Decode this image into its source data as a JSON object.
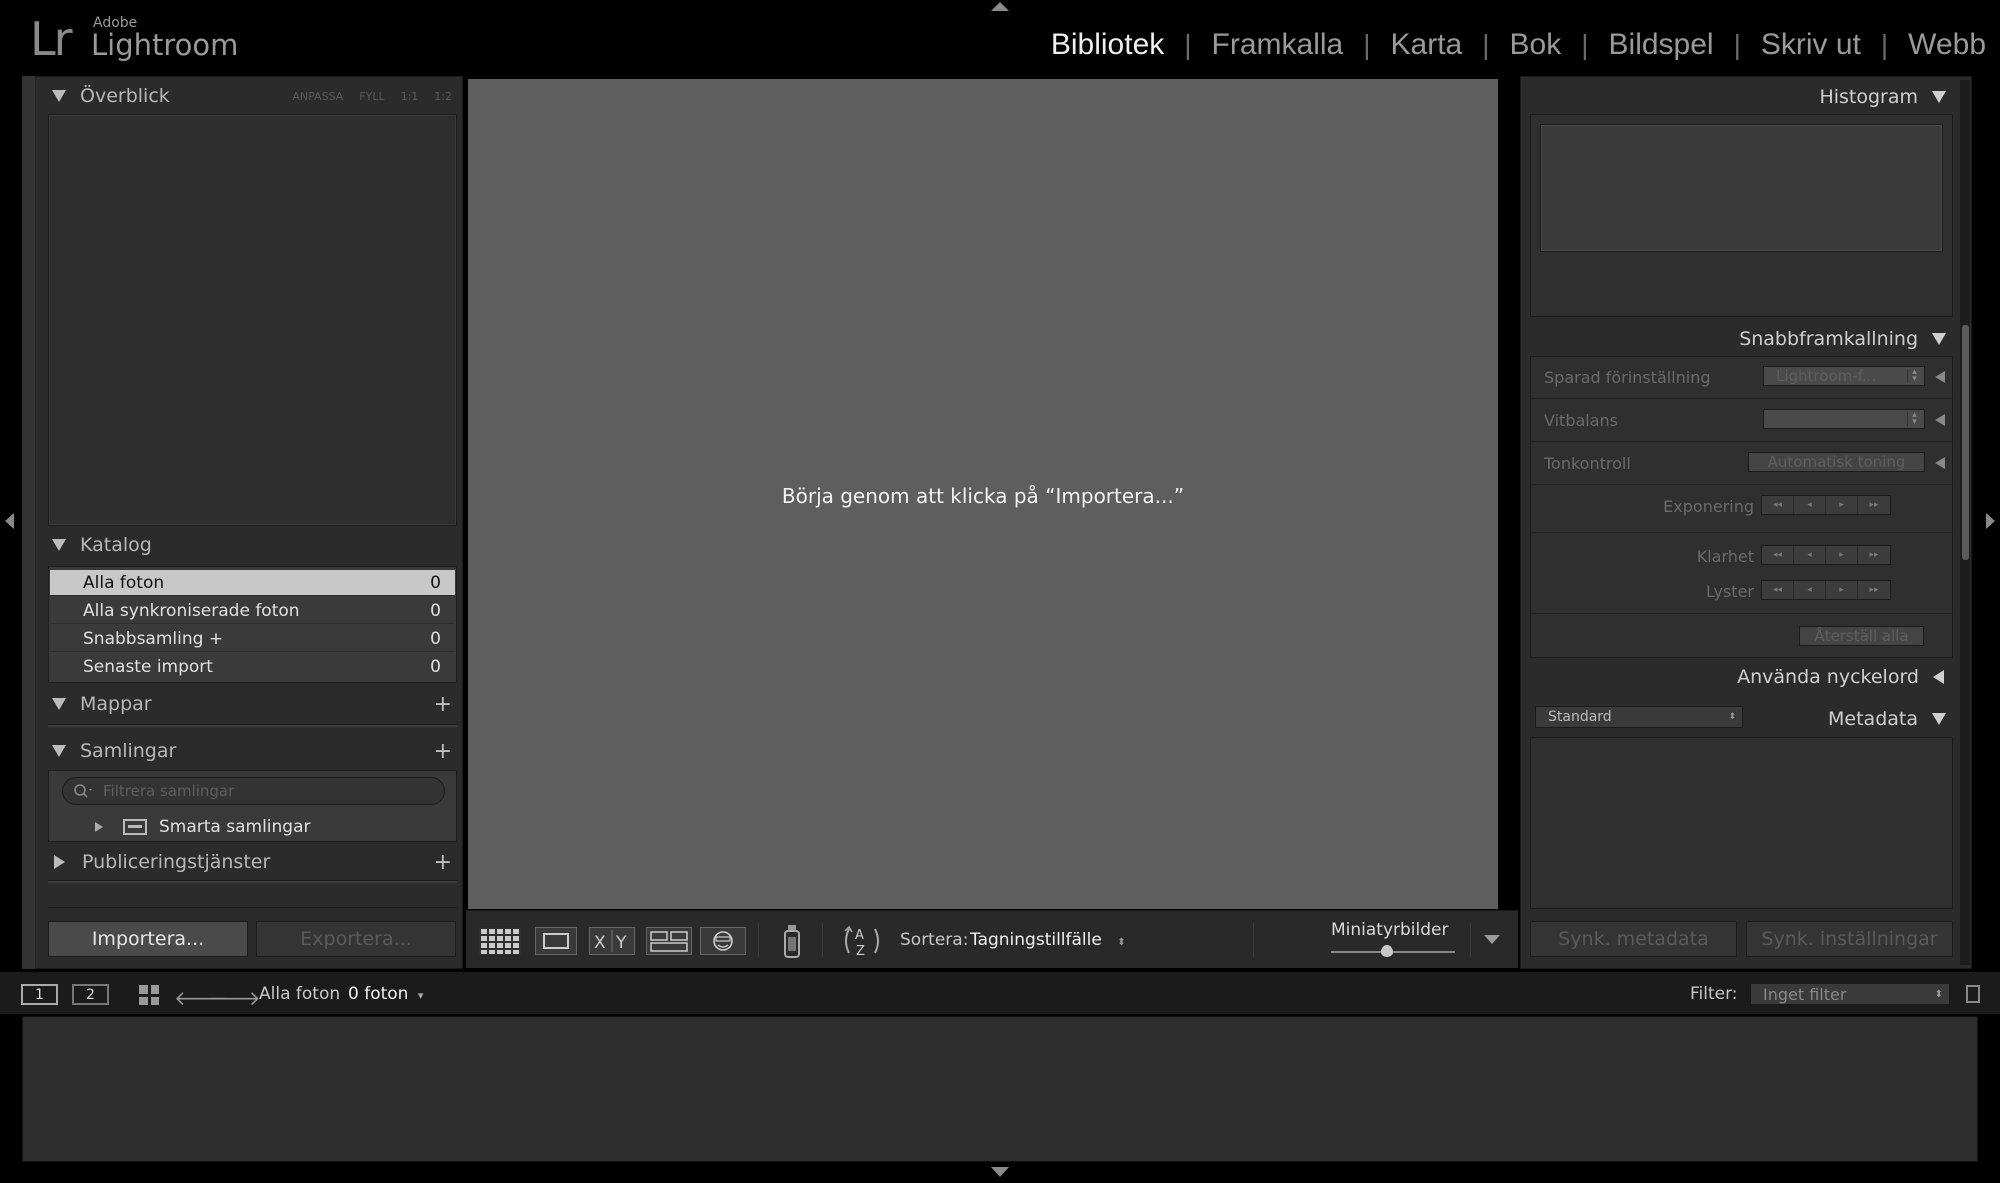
{
  "app": {
    "logo_mark": "Lr",
    "logo_vendor": "Adobe",
    "logo_name": "Lightroom"
  },
  "modules": [
    {
      "label": "Bibliotek",
      "active": true
    },
    {
      "label": "Framkalla",
      "active": false
    },
    {
      "label": "Karta",
      "active": false
    },
    {
      "label": "Bok",
      "active": false
    },
    {
      "label": "Bildspel",
      "active": false
    },
    {
      "label": "Skriv ut",
      "active": false
    },
    {
      "label": "Webb",
      "active": false
    }
  ],
  "left_panel": {
    "navigator": {
      "title": "Överblick",
      "zoom_options": [
        "ANPASSA",
        "FYLL",
        "1:1",
        "1:2"
      ]
    },
    "catalog": {
      "title": "Katalog",
      "items": [
        {
          "label": "Alla foton",
          "count": "0",
          "selected": true
        },
        {
          "label": "Alla synkroniserade foton",
          "count": "0",
          "selected": false
        },
        {
          "label": "Snabbsamling +",
          "count": "0",
          "selected": false
        },
        {
          "label": "Senaste import",
          "count": "0",
          "selected": false
        }
      ]
    },
    "folders": {
      "title": "Mappar",
      "add": "+"
    },
    "collections": {
      "title": "Samlingar",
      "add": "+",
      "filter_placeholder": "Filtrera samlingar",
      "smart_collections": "Smarta samlingar"
    },
    "publish": {
      "title": "Publiceringstjänster",
      "add": "+"
    },
    "import_label": "Importera...",
    "export_label": "Exportera..."
  },
  "center": {
    "message": "Börja genom att klicka på “Importera...”"
  },
  "toolbar": {
    "sort_label": "Sortera:",
    "sort_value": "Tagningstillfälle",
    "thumbnails_label": "Miniatyrbilder",
    "thumbnail_size": 0.45
  },
  "right_panel": {
    "histogram": {
      "title": "Histogram"
    },
    "quick_develop": {
      "title": "Snabbframkallning",
      "saved_preset_label": "Sparad förinställning",
      "saved_preset_value": "Lightroom-f...",
      "white_balance_label": "Vitbalans",
      "white_balance_value": "",
      "tone_control_label": "Tonkontroll",
      "auto_tone_label": "Automatisk toning",
      "exposure_label": "Exponering",
      "clarity_label": "Klarhet",
      "vibrance_label": "Lyster",
      "reset_all_label": "Återställ alla"
    },
    "keywording": {
      "title": "Använda nyckelord"
    },
    "metadata": {
      "title": "Metadata",
      "preset": "Standard"
    },
    "sync_metadata_label": "Synk. metadata",
    "sync_settings_label": "Synk. inställningar"
  },
  "filmstrip": {
    "screen1": "1",
    "screen2": "2",
    "source": "Alla foton",
    "count": "0 foton",
    "filter_label": "Filter:",
    "filter_value": "Inget filter"
  }
}
